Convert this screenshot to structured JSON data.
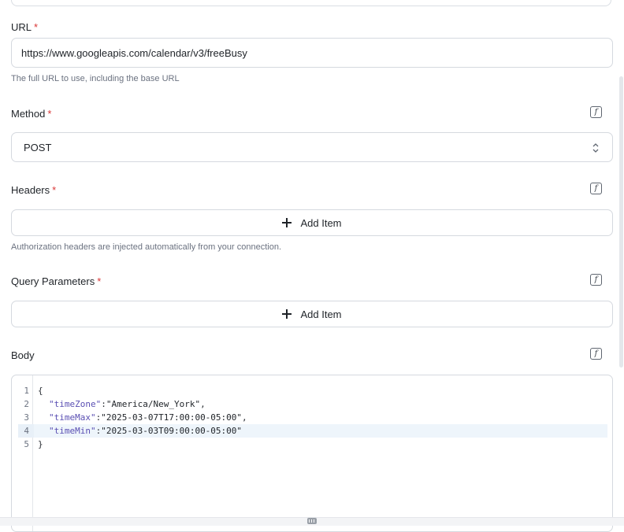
{
  "url_field": {
    "label": "URL",
    "required_mark": "*",
    "value": "https://www.googleapis.com/calendar/v3/freeBusy",
    "help": "The full URL to use, including the base URL"
  },
  "method_field": {
    "label": "Method",
    "required_mark": "*",
    "value": "POST",
    "fx_label": "f"
  },
  "headers_field": {
    "label": "Headers",
    "required_mark": "*",
    "add_label": "Add Item",
    "help": "Authorization headers are injected automatically from your connection.",
    "fx_label": "f"
  },
  "query_field": {
    "label": "Query Parameters",
    "required_mark": "*",
    "add_label": "Add Item",
    "fx_label": "f"
  },
  "body_field": {
    "label": "Body",
    "fx_label": "f",
    "lines": [
      {
        "num": "1",
        "text": "{"
      },
      {
        "num": "2",
        "key": "\"timeZone\"",
        "sep": ":",
        "value": "\"America/New_York\"",
        "end": ","
      },
      {
        "num": "3",
        "key": "\"timeMax\"",
        "sep": ":",
        "value": "\"2025-03-07T17:00:00-05:00\"",
        "end": ","
      },
      {
        "num": "4",
        "key": "\"timeMin\"",
        "sep": ":",
        "value": "\"2025-03-03T09:00:00-05:00\"",
        "end": ""
      },
      {
        "num": "5",
        "text": "}"
      }
    ]
  },
  "colors": {
    "required": "#d93636",
    "json_key": "#5a4fb3",
    "active_line": "#eef5fb"
  }
}
